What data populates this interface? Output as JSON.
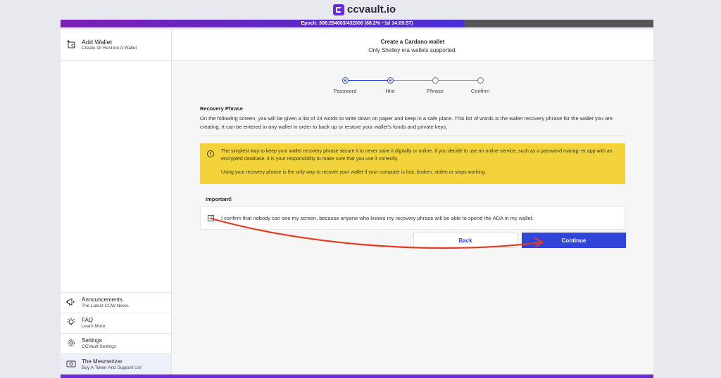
{
  "brand": {
    "name": "ccvault.io",
    "accent": "#6b2bd8"
  },
  "epoch": {
    "text": "Epoch: 306:294603/432000 (68.2% ~1d 14:09:57)",
    "progress": 0.682
  },
  "sidebar": {
    "header": {
      "title": "Add Wallet",
      "subtitle": "Create Or Restore A Wallet",
      "icon": "add-wallet-icon"
    },
    "items": [
      {
        "title": "Announcements",
        "subtitle": "The Latest CCW News.",
        "icon": "megaphone-icon"
      },
      {
        "title": "FAQ",
        "subtitle": "Learn More.",
        "icon": "lightbulb-icon"
      },
      {
        "title": "Settings",
        "subtitle": "CCVault Settings",
        "icon": "gear-icon"
      },
      {
        "title": "The Mesmerizer",
        "subtitle": "Buy A Token And Support Us!",
        "icon": "token-icon"
      }
    ]
  },
  "main": {
    "header": {
      "title": "Create a Cardano wallet",
      "subtitle": "Only Shelley era wallets supported."
    },
    "steps": [
      {
        "label": "Password",
        "state": "done"
      },
      {
        "label": "Hint",
        "state": "done"
      },
      {
        "label": "Phrase",
        "state": "pending"
      },
      {
        "label": "Confirm",
        "state": "pending"
      }
    ],
    "recovery": {
      "title": "Recovery Phrase",
      "body": "On the following screen, you will be given a list of 24 words to write down on paper and keep in a safe place. This list of words is the wallet recovery phrase for the wallet you are creating. It can be entered in any wallet in order to back up or restore your wallet's funds and private keys."
    },
    "warning": {
      "line1": "The simplest way to keep your wallet recovery phrase secure it to never store it digitally or online. If you decide to use an online service, such as a password manag- er app with an encrypted database, it is your responsibility to make sure that you use it correctly.",
      "line2": "Using your recovery phrase is the only way to recover your wallet if your computer is lost, broken, stolen or stops working.",
      "color": "#f2d33b"
    },
    "important": {
      "title": "Important!",
      "confirm_text": "I confirm that nobody can see my screen, because anyone who knows my recovery phrase will be able to spend the ADA in my wallet.",
      "checked": true
    },
    "buttons": {
      "back": "Back",
      "continue": "Continue"
    }
  },
  "annotation": {
    "arrow_color": "#e53a1e"
  }
}
